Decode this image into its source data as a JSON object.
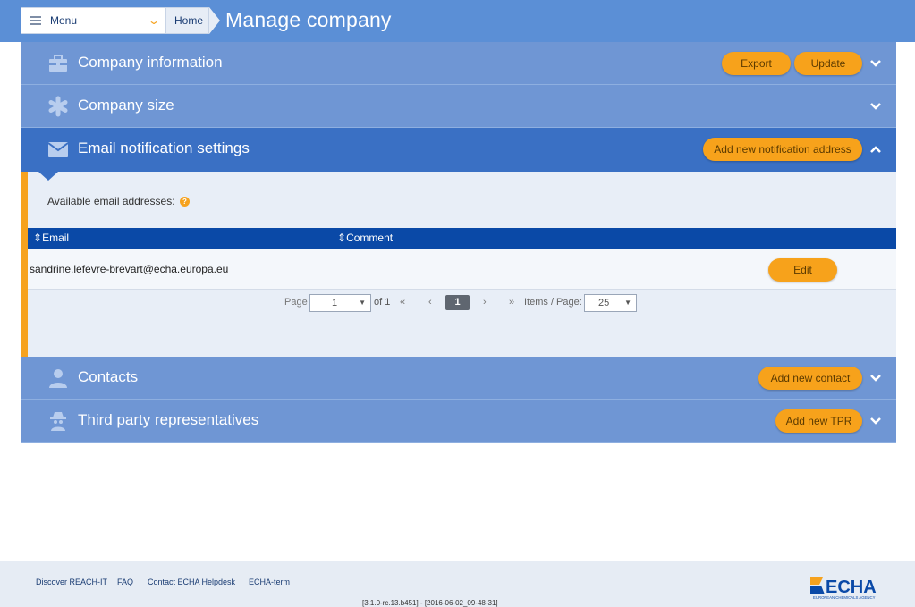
{
  "header": {
    "menu_label": "Menu",
    "breadcrumb_home": "Home",
    "page_title": "Manage company"
  },
  "sections": {
    "company_info": {
      "title": "Company information",
      "export_label": "Export",
      "update_label": "Update"
    },
    "company_size": {
      "title": "Company size"
    },
    "email_settings": {
      "title": "Email notification settings",
      "add_label": "Add new notification address"
    },
    "contacts": {
      "title": "Contacts",
      "add_label": "Add new contact"
    },
    "tpr": {
      "title": "Third party representatives",
      "add_label": "Add new TPR"
    }
  },
  "email_panel": {
    "available_label": "Available email addresses:",
    "help_glyph": "?",
    "columns": [
      "Email",
      "Comment"
    ],
    "rows": [
      {
        "email": "sandrine.lefevre-brevart@echa.europa.eu",
        "comment": "",
        "action": "Edit"
      }
    ]
  },
  "pagination": {
    "page_label": "Page",
    "page_value": "1",
    "of_label": "of 1",
    "first": "«",
    "prev": "‹",
    "current": "1",
    "next": "›",
    "last": "»",
    "items_label": "Items / Page:",
    "items_value": "25"
  },
  "footer": {
    "links": [
      "Discover REACH-IT",
      "FAQ",
      "Contact ECHA Helpdesk",
      "ECHA-term"
    ],
    "version": "[3.1.0-rc.13.b451] - [2016-06-02_09-48-31]",
    "logo_text": "ECHA",
    "logo_subtext": "EUROPEAN CHEMICALS AGENCY"
  },
  "colors": {
    "header_bg": "#5b8fd6",
    "section_bg": "#6f96d4",
    "section_active_bg": "#3a70c4",
    "accent_orange": "#f7a21b",
    "table_header_bg": "#0a49a7"
  },
  "icons": [
    "menu-icon",
    "chevron-down-icon",
    "briefcase-icon",
    "asterisk-icon",
    "envelope-icon",
    "user-icon",
    "spy-icon",
    "sort-icon",
    "help-icon",
    "chevron-up-icon"
  ]
}
